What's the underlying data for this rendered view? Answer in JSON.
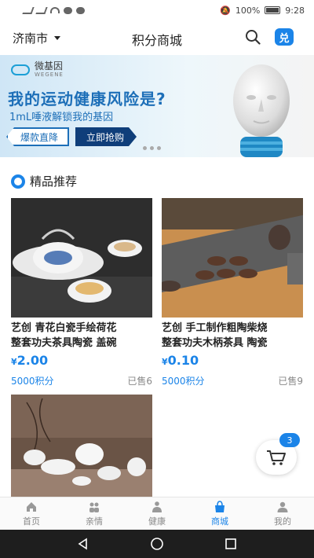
{
  "status_bar": {
    "battery": "100%",
    "time": "9:28"
  },
  "header": {
    "city": "济南市",
    "title": "积分商城",
    "exchange_label": "兑"
  },
  "banner": {
    "logo_cn": "微基因",
    "logo_en": "WEGENE",
    "headline": "我的运动健康风险是?",
    "subline": "1mL唾液解锁我的基因",
    "hot_label": "爆款直降",
    "buy_label": "立即抢购"
  },
  "section": {
    "title": "精品推荐"
  },
  "products": [
    {
      "name_line1": "艺创 青花白瓷手绘荷花",
      "name_line2": "整套功夫茶具陶瓷 盖碗",
      "currency": "¥",
      "price": "2.00",
      "points": "5000积分",
      "sold": "已售6"
    },
    {
      "name_line1": "艺创 手工制作粗陶柴烧",
      "name_line2": "整套功夫木柄茶具 陶瓷",
      "currency": "¥",
      "price": "0.10",
      "points": "5000积分",
      "sold": "已售9"
    }
  ],
  "cart": {
    "count": "3"
  },
  "tabs": [
    {
      "label": "首页",
      "icon": "home-icon"
    },
    {
      "label": "亲情",
      "icon": "family-icon"
    },
    {
      "label": "健康",
      "icon": "health-icon"
    },
    {
      "label": "商城",
      "icon": "shop-icon",
      "active": true
    },
    {
      "label": "我的",
      "icon": "profile-icon"
    }
  ],
  "colors": {
    "accent": "#1b84e8",
    "banner_text": "#1d6fb8"
  }
}
